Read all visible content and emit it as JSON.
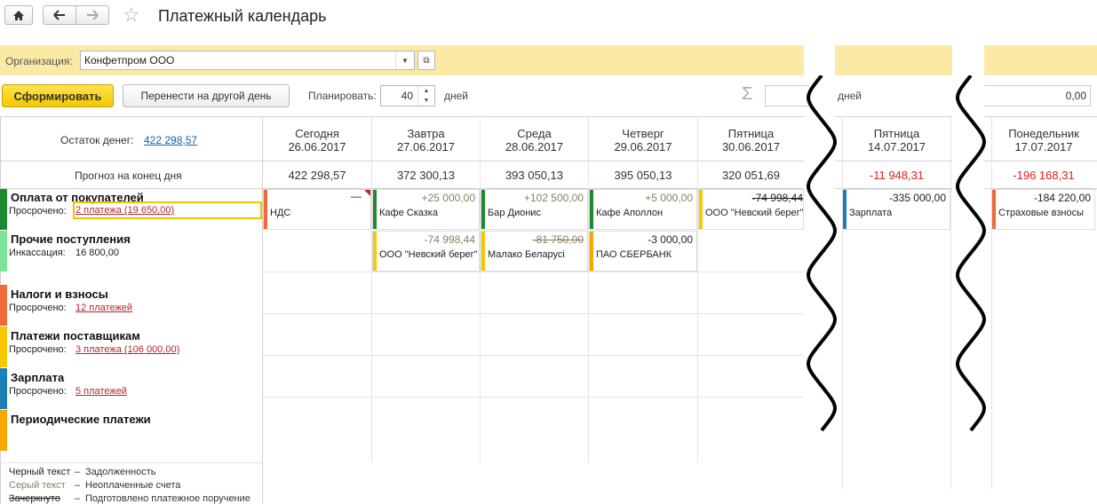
{
  "title": "Платежный календарь",
  "org": {
    "label": "Организация:",
    "value": "Конфетпром ООО"
  },
  "toolbar": {
    "generate": "Сформировать",
    "move": "Перенести на другой день",
    "plan_label": "Планировать:",
    "plan_days": "40",
    "days_unit": "дней",
    "days_unit2": "дней",
    "sum_value": "0,00"
  },
  "balance": {
    "label": "Остаток денег:",
    "value": "422 298,57"
  },
  "forecast_label": "Прогноз на конец дня",
  "days": [
    {
      "name": "Сегодня",
      "date": "26.06.2017",
      "forecast": "422 298,57"
    },
    {
      "name": "Завтра",
      "date": "27.06.2017",
      "forecast": "372 300,13"
    },
    {
      "name": "Среда",
      "date": "28.06.2017",
      "forecast": "393 050,13"
    },
    {
      "name": "Четверг",
      "date": "29.06.2017",
      "forecast": "395 050,13"
    },
    {
      "name": "Пятница",
      "date": "30.06.2017",
      "forecast": "320 051,69"
    },
    {
      "name": "Пятница",
      "date": "14.07.2017",
      "forecast": "-11 948,31"
    },
    {
      "name": "Понедельник",
      "date": "17.07.2017",
      "forecast": "-196 168,31"
    }
  ],
  "categories": [
    {
      "title": "Оплата от покупателей",
      "sub_label": "Просрочено:",
      "sub_value": "2 платежа (19 650,00)",
      "color": "#1e8a2e"
    },
    {
      "title": "Прочие поступления",
      "sub_label": "Инкассация:",
      "sub_value": "16 800,00",
      "color": "#7de39a"
    },
    {
      "title": "Налоги и взносы",
      "sub_label": "Просрочено:",
      "sub_value": "12 платежей",
      "color": "#f26a3a"
    },
    {
      "title": "Платежи поставщикам",
      "sub_label": "Просрочено:",
      "sub_value": "3 платежа (106 000,00)",
      "color": "#f5c800"
    },
    {
      "title": "Зарплата",
      "sub_label": "Просрочено:",
      "sub_value": "5 платежей",
      "color": "#1e7fb8"
    },
    {
      "title": "Периодические платежи",
      "color": "#f5a800"
    }
  ],
  "cells": {
    "c0": {
      "amount": "",
      "name": "НДС",
      "color": "#f26a3a"
    },
    "c1": {
      "amount": "+25 000,00",
      "name": "Кафе Сказка",
      "color": "#1e8a2e"
    },
    "c2": {
      "amount": "+102 500,00",
      "name": "Бар Дионис",
      "color": "#1e8a2e"
    },
    "c3": {
      "amount": "+5 000,00",
      "name": "Кафе Аполлон",
      "color": "#1e8a2e"
    },
    "c4": {
      "amount": "-74 998,44",
      "name": "ООО \"Невский берег\"",
      "color": "#f5c800"
    },
    "c5": {
      "amount": "-74 998,44",
      "name": "ООО \"Невский берег\"",
      "color": "#f5c800"
    },
    "c6": {
      "amount": "-81 750,00",
      "name": "Малако Беларусі",
      "color": "#f5c800"
    },
    "c7": {
      "amount": "-3 000,00",
      "name": "ПАО СБЕРБАНК",
      "color": "#f5a800"
    },
    "c8": {
      "amount": "-335 000,00",
      "name": "Зарплата",
      "color": "#1e7fb8"
    },
    "c9": {
      "amount": "-184 220,00",
      "name": "Страховые взносы",
      "color": "#f26a3a"
    }
  },
  "legend": [
    {
      "key": "Черный текст",
      "sep": "–",
      "desc": "Задолженность"
    },
    {
      "key": "Серый текст",
      "sep": "–",
      "desc": "Неоплаченные счета"
    },
    {
      "key": "Зачеркнуто",
      "sep": "–",
      "desc": "Подготовлено платежное поручение"
    }
  ],
  "icons": {
    "home": "home-icon",
    "back": "arrow-left-icon",
    "forward": "arrow-right-icon",
    "star": "star-icon",
    "sum": "sigma-icon"
  }
}
